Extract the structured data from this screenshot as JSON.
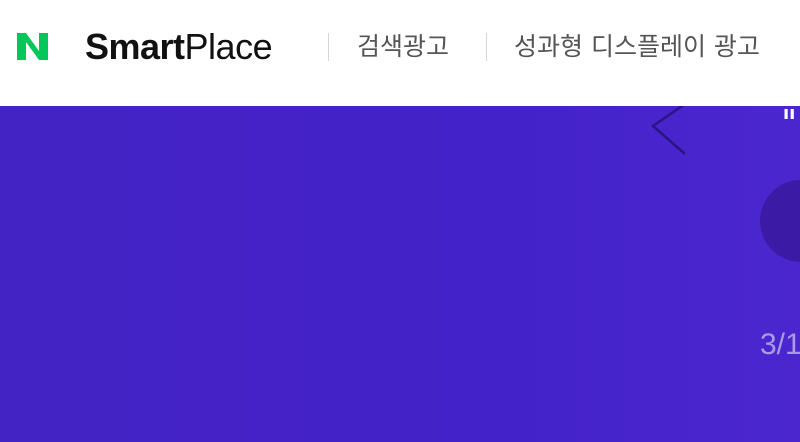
{
  "header": {
    "logo_letter": "N",
    "brand": {
      "smart": "Smart",
      "place": "Place"
    },
    "nav": [
      {
        "label": "검색광고"
      },
      {
        "label": "성과형 디스플레이 광고"
      }
    ]
  },
  "hero": {
    "banner_text_fragment": "ıı",
    "page_counter": "3/1"
  },
  "colors": {
    "logo_green": "#03c75a",
    "hero_purple": "#4322c9",
    "counter_text": "#a99ae6"
  },
  "icons": {
    "logo": "naver-n-logo",
    "prev": "chevron-left-icon",
    "circle": "carousel-control-button"
  }
}
